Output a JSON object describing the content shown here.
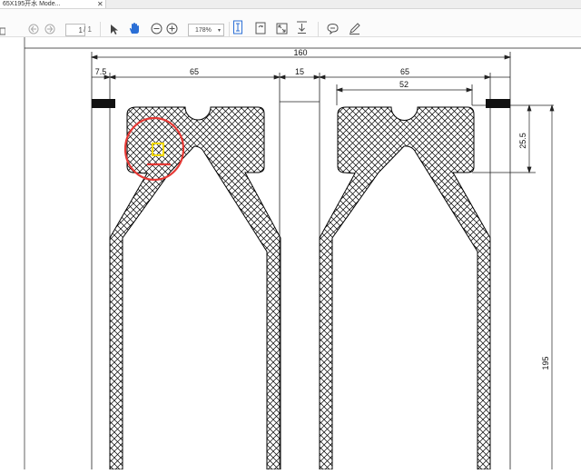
{
  "tab": {
    "title": "65X195开水 Mode...",
    "close": "✕"
  },
  "toolbar": {
    "page_current": "1",
    "page_total": "/ 1",
    "zoom": "178%",
    "zoom_caret": "▾"
  },
  "drawing": {
    "dim_overall": "160",
    "dim_left_margin": "7.5",
    "dim_left_width": "65",
    "dim_gap": "15",
    "dim_right_width": "65",
    "dim_inner_width": "52",
    "dim_head_height": "25.5",
    "dim_total_height": "195"
  },
  "colors": {
    "annotation_circle": "#e53935",
    "highlight_box": "#f2d900",
    "bar": "#111111"
  }
}
